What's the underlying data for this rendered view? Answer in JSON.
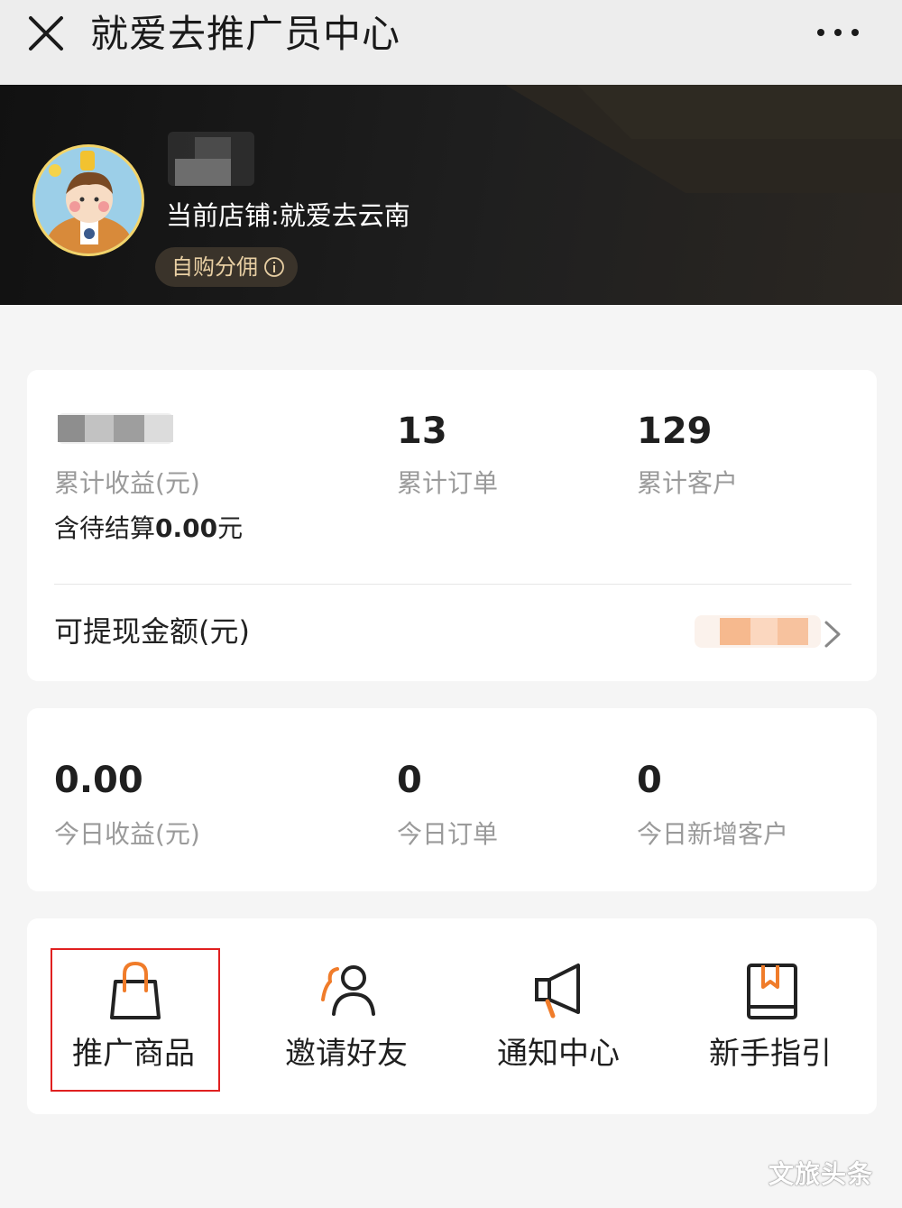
{
  "header": {
    "title": "就爱去推广员中心"
  },
  "profile": {
    "store": "当前店铺:就爱去云南",
    "tag": "自购分佣"
  },
  "summary": {
    "total_income_label": "累计收益(元)",
    "pending_prefix": "含待结算",
    "pending_amount": "0.00",
    "pending_suffix": "元",
    "total_orders_value": "13",
    "total_orders_label": "累计订单",
    "total_customers_value": "129",
    "total_customers_label": "累计客户",
    "withdraw_label": "可提现金额(元)"
  },
  "today": {
    "income_value": "0.00",
    "income_label": "今日收益(元)",
    "orders_value": "0",
    "orders_label": "今日订单",
    "customers_value": "0",
    "customers_label": "今日新增客户"
  },
  "menu": [
    {
      "label": "推广商品",
      "icon": "shopping-bag-icon"
    },
    {
      "label": "邀请好友",
      "icon": "invite-user-icon"
    },
    {
      "label": "通知中心",
      "icon": "megaphone-icon"
    },
    {
      "label": "新手指引",
      "icon": "guide-book-icon"
    }
  ],
  "watermark": "文旅头条",
  "colors": {
    "accent": "#f07c2a",
    "highlight_border": "#e02020",
    "banner": "#1a1a1a",
    "tag_text": "#e8cfa3"
  }
}
